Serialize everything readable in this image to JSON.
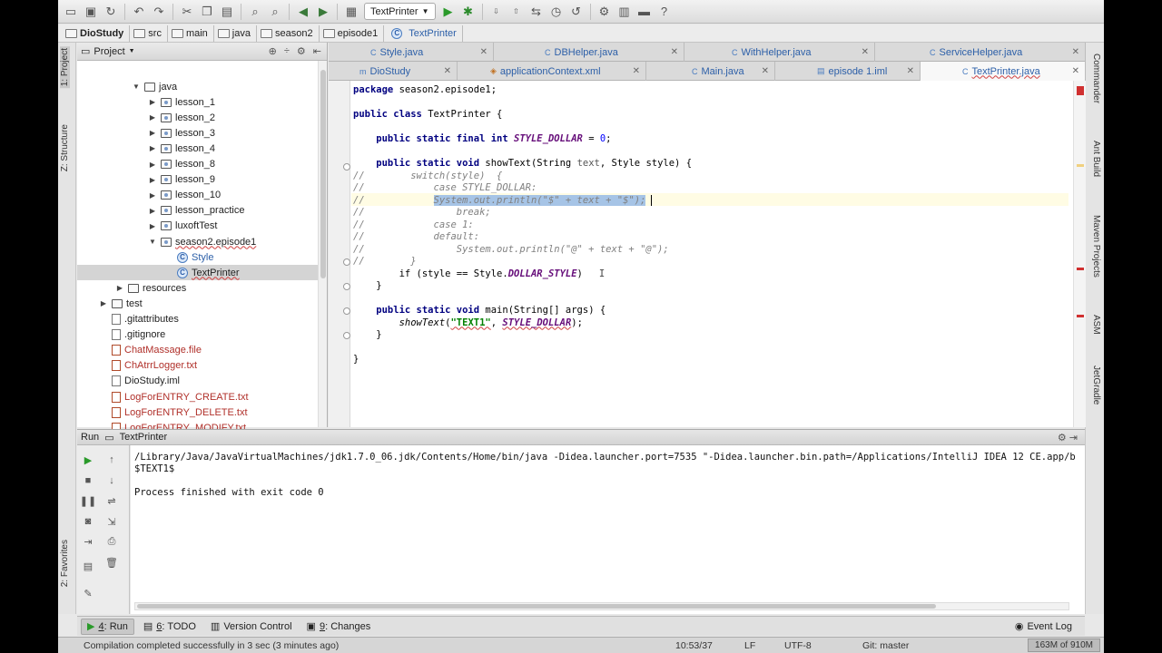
{
  "toolbar": {
    "run_config": "TextPrinter",
    "icons": [
      "open-icon",
      "save-icon",
      "sync-icon",
      "undo-icon",
      "redo-icon",
      "cut-icon",
      "copy-icon",
      "paste-icon",
      "find-icon",
      "replace-icon",
      "back-icon",
      "forward-icon",
      "build-icon",
      "run-icon",
      "debug-icon",
      "vcs-update-icon",
      "vcs-commit-icon",
      "vcs-compare-icon",
      "vcs-history-icon",
      "revert-icon",
      "settings-icon",
      "structure-icon",
      "sdk-icon",
      "help-icon"
    ]
  },
  "breadcrumb": [
    "DioStudy",
    "src",
    "main",
    "java",
    "season2",
    "episode1",
    "TextPrinter"
  ],
  "left_strip": {
    "project": "1: Project",
    "structure": "Z: Structure",
    "favorites": "2: Favorites"
  },
  "right_strip": {
    "commander": "Commander",
    "ant": "Ant Build",
    "maven": "Maven Projects",
    "asm": "ASM",
    "jetgradle": "JetGradle"
  },
  "project": {
    "title": "Project",
    "tree": [
      {
        "label": "java",
        "kind": "folder",
        "depth": 3,
        "arrow": "down"
      },
      {
        "label": "lesson_1",
        "kind": "package",
        "depth": 4,
        "arrow": "right"
      },
      {
        "label": "lesson_2",
        "kind": "package",
        "depth": 4,
        "arrow": "right"
      },
      {
        "label": "lesson_3",
        "kind": "package",
        "depth": 4,
        "arrow": "right"
      },
      {
        "label": "lesson_4",
        "kind": "package",
        "depth": 4,
        "arrow": "right"
      },
      {
        "label": "lesson_8",
        "kind": "package",
        "depth": 4,
        "arrow": "right"
      },
      {
        "label": "lesson_9",
        "kind": "package",
        "depth": 4,
        "arrow": "right"
      },
      {
        "label": "lesson_10",
        "kind": "package",
        "depth": 4,
        "arrow": "right"
      },
      {
        "label": "lesson_practice",
        "kind": "package",
        "depth": 4,
        "arrow": "right"
      },
      {
        "label": "luxoftTest",
        "kind": "package",
        "depth": 4,
        "arrow": "right"
      },
      {
        "label": "season2.episode1",
        "kind": "package",
        "depth": 4,
        "arrow": "down",
        "link": true
      },
      {
        "label": "Style",
        "kind": "class",
        "depth": 5,
        "arrow": "",
        "blue": true
      },
      {
        "label": "TextPrinter",
        "kind": "class",
        "depth": 5,
        "arrow": "",
        "selected": true,
        "link": true
      },
      {
        "label": "resources",
        "kind": "folder",
        "depth": 2,
        "arrow": "right"
      },
      {
        "label": "test",
        "kind": "folder",
        "depth": 1,
        "arrow": "right"
      },
      {
        "label": ".gitattributes",
        "kind": "file",
        "depth": 1,
        "arrow": ""
      },
      {
        "label": ".gitignore",
        "kind": "file",
        "depth": 1,
        "arrow": ""
      },
      {
        "label": "ChatMassage.file",
        "kind": "log",
        "depth": 1,
        "arrow": "",
        "red": true
      },
      {
        "label": "ChAtrrLogger.txt",
        "kind": "log",
        "depth": 1,
        "arrow": "",
        "red": true
      },
      {
        "label": "DioStudy.iml",
        "kind": "file",
        "depth": 1,
        "arrow": ""
      },
      {
        "label": "LogForENTRY_CREATE.txt",
        "kind": "log",
        "depth": 1,
        "arrow": "",
        "red": true
      },
      {
        "label": "LogForENTRY_DELETE.txt",
        "kind": "log",
        "depth": 1,
        "arrow": "",
        "red": true
      },
      {
        "label": "LogForENTRY_MODIFY.txt",
        "kind": "log",
        "depth": 1,
        "arrow": "",
        "red": true
      }
    ]
  },
  "tabs_row1": [
    {
      "label": "Style.java",
      "icon": "C"
    },
    {
      "label": "DBHelper.java",
      "icon": "C"
    },
    {
      "label": "WithHelper.java",
      "icon": "C"
    },
    {
      "label": "ServiceHelper.java",
      "icon": "C"
    }
  ],
  "tabs_row2": [
    {
      "label": "DioStudy",
      "icon": "m"
    },
    {
      "label": "applicationContext.xml",
      "icon": "x"
    },
    {
      "label": "Main.java",
      "icon": "C"
    },
    {
      "label": "episode 1.iml",
      "icon": "i"
    },
    {
      "label": "TextPrinter.java",
      "icon": "C",
      "active": true
    }
  ],
  "code": {
    "l1a": "package ",
    "l1b": "season2.episode1;",
    "l2a": "public class ",
    "l2b": "TextPrinter {",
    "l3a": "    public static final int ",
    "l3b": "STYLE_DOLLAR",
    "l3c": " = ",
    "l3d": "0",
    "l3e": ";",
    "l4a": "    public static void ",
    "l4b": "showText(String ",
    "l4c": "text",
    "l4d": ", Style ",
    "l4e": "style",
    "l4f": ") {",
    "l5": "//        switch(style)  {",
    "l6": "//            case STYLE_DOLLAR:",
    "l7a": "//            ",
    "l7b": "System.out.println(\"$\" + text + \"$\");",
    "l8": "//                break;",
    "l9": "//            case 1:",
    "l10": "//            default:",
    "l11": "//                System.out.println(\"@\" + text + \"@\");",
    "l12": "//        }",
    "l13a": "        if (style == Style.",
    "l13b": "DOLLAR_STYLE",
    "l13c": ")",
    "l14": "    }",
    "l15a": "    public static void ",
    "l15b": "main(String[] args) {",
    "l16a": "        ",
    "l16b": "showText",
    "l16c": "(",
    "l16d": "\"TEXT1\"",
    "l16e": ", ",
    "l16f": "STYLE_DOLLAR",
    "l16g": ");",
    "l17": "    }",
    "l18": "}"
  },
  "run": {
    "title": "Run",
    "config": "TextPrinter",
    "lines": [
      "/Library/Java/JavaVirtualMachines/jdk1.7.0_06.jdk/Contents/Home/bin/java -Didea.launcher.port=7535 \"-Didea.launcher.bin.path=/Applications/IntelliJ IDEA 12 CE.app/b",
      "$TEXT1$",
      "",
      "Process finished with exit code 0"
    ]
  },
  "bottom_tabs": [
    {
      "num": "4",
      "label": ": Run",
      "icon": "run-icon",
      "active": true
    },
    {
      "num": "6",
      "label": ": TODO",
      "icon": "todo-icon"
    },
    {
      "num": "",
      "label": "Version Control",
      "icon": "vcs-icon"
    },
    {
      "num": "9",
      "label": ": Changes",
      "icon": "changes-icon"
    }
  ],
  "event_log": "Event Log",
  "status": {
    "message": "Compilation completed successfully in 3 sec (3 minutes ago)",
    "position": "10:53/37",
    "line_sep": "LF",
    "encoding": "UTF-8",
    "git": "Git: master",
    "memory": "163M of 910M"
  },
  "colors": {
    "accent": "#2c5fa8",
    "selection": "#a6c4e6",
    "error_mark": "#d03030"
  }
}
